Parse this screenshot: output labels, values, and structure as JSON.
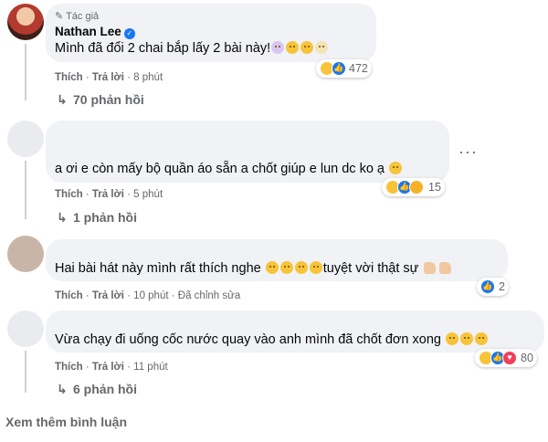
{
  "comments": [
    {
      "badge": "Tác giả",
      "name": "Nathan Lee",
      "text": "Mình đã đổi 2 chai bắp lấy 2 bài này!",
      "reaction_count": "472",
      "like": "Thích",
      "reply": "Trả lời",
      "time": "8 phút",
      "replies": "70 phản hồi"
    },
    {
      "text": "a ơi e còn mấy bộ quần áo sẵn a chốt giúp e lun dc ko ạ",
      "reaction_count": "15",
      "like": "Thích",
      "reply": "Trả lời",
      "time": "5 phút",
      "replies": "1 phản hồi"
    },
    {
      "text": "Hai bài hát này mình rất thích nghe",
      "text_tail": "tuyệt vời thật sự",
      "reaction_count": "2",
      "like": "Thích",
      "reply": "Trả lời",
      "time": "10 phút",
      "edited": "Đã chỉnh sửa"
    },
    {
      "text": "Vừa chạy đi uống cốc nước quay vào anh mình đã chốt đơn xong",
      "reaction_count": "80",
      "like": "Thích",
      "reply": "Trả lời",
      "time": "11 phút",
      "replies": "6 phản hồi"
    }
  ],
  "more_options": "···",
  "see_more": "Xem thêm bình luận",
  "icons": {
    "author": "pencil-icon",
    "verified": "verified-check-icon",
    "reply_arrow": "reply-arrow-icon"
  }
}
